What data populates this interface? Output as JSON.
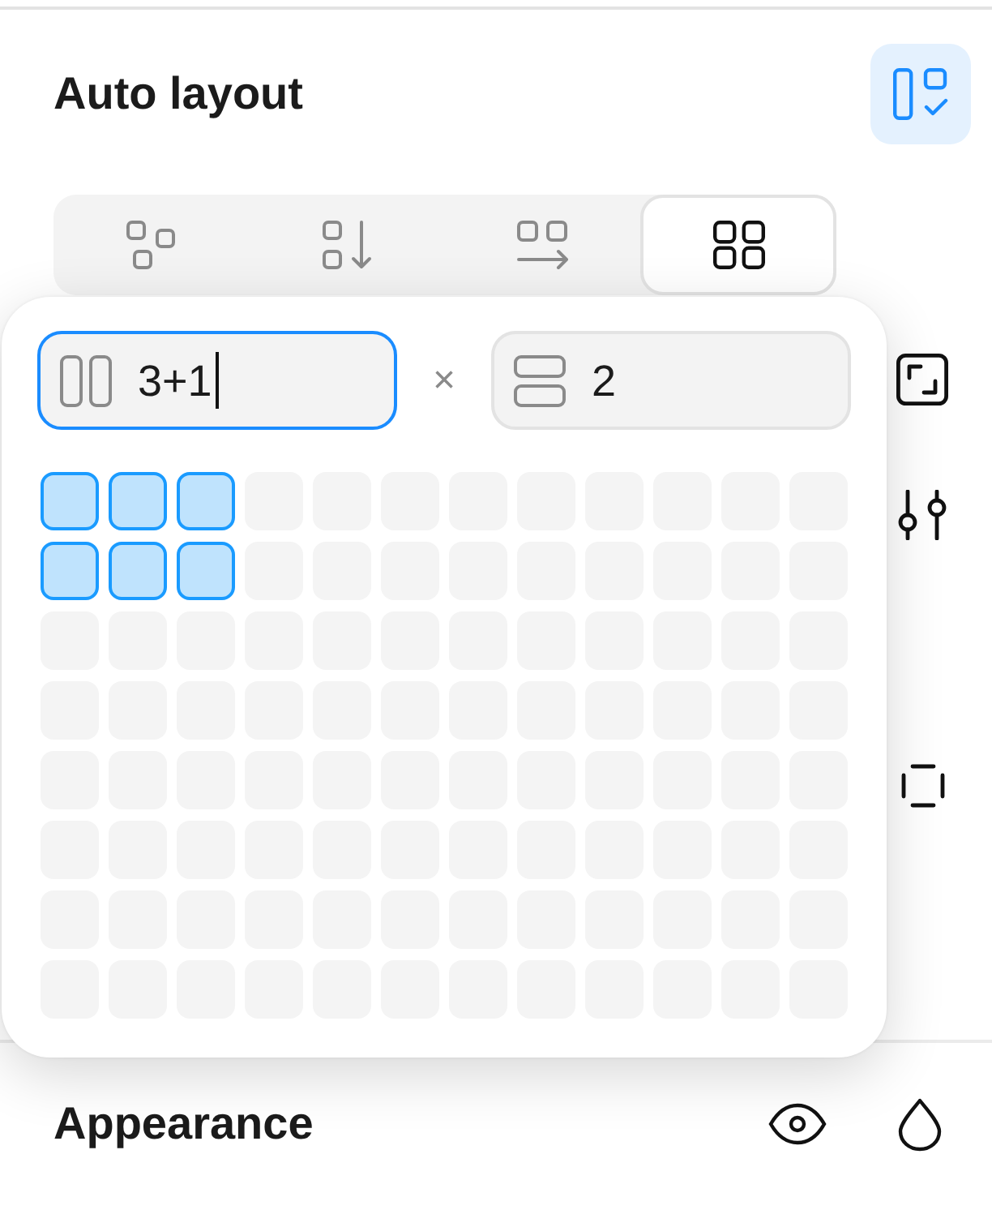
{
  "auto_layout": {
    "title": "Auto layout",
    "toggle": {
      "on": true
    }
  },
  "flow_options": [
    {
      "kind": "freeform",
      "selected": false
    },
    {
      "kind": "vertical",
      "selected": false
    },
    {
      "kind": "horizontal",
      "selected": false
    },
    {
      "kind": "grid",
      "selected": true
    }
  ],
  "grid_popover": {
    "columns_field": {
      "value": "3+1",
      "focused": true
    },
    "separator": "×",
    "rows_field": {
      "value": "2",
      "focused": false
    },
    "rows": [
      {
        "cells": [
          {
            "selected": true
          },
          {
            "selected": true
          },
          {
            "selected": true
          },
          {
            "selected": false
          },
          {
            "selected": false
          },
          {
            "selected": false
          },
          {
            "selected": false
          },
          {
            "selected": false
          },
          {
            "selected": false
          },
          {
            "selected": false
          },
          {
            "selected": false
          },
          {
            "selected": false
          }
        ]
      },
      {
        "cells": [
          {
            "selected": true
          },
          {
            "selected": true
          },
          {
            "selected": true
          },
          {
            "selected": false
          },
          {
            "selected": false
          },
          {
            "selected": false
          },
          {
            "selected": false
          },
          {
            "selected": false
          },
          {
            "selected": false
          },
          {
            "selected": false
          },
          {
            "selected": false
          },
          {
            "selected": false
          }
        ]
      },
      {
        "cells": [
          {
            "selected": false
          },
          {
            "selected": false
          },
          {
            "selected": false
          },
          {
            "selected": false
          },
          {
            "selected": false
          },
          {
            "selected": false
          },
          {
            "selected": false
          },
          {
            "selected": false
          },
          {
            "selected": false
          },
          {
            "selected": false
          },
          {
            "selected": false
          },
          {
            "selected": false
          }
        ]
      },
      {
        "cells": [
          {
            "selected": false
          },
          {
            "selected": false
          },
          {
            "selected": false
          },
          {
            "selected": false
          },
          {
            "selected": false
          },
          {
            "selected": false
          },
          {
            "selected": false
          },
          {
            "selected": false
          },
          {
            "selected": false
          },
          {
            "selected": false
          },
          {
            "selected": false
          },
          {
            "selected": false
          }
        ]
      },
      {
        "cells": [
          {
            "selected": false
          },
          {
            "selected": false
          },
          {
            "selected": false
          },
          {
            "selected": false
          },
          {
            "selected": false
          },
          {
            "selected": false
          },
          {
            "selected": false
          },
          {
            "selected": false
          },
          {
            "selected": false
          },
          {
            "selected": false
          },
          {
            "selected": false
          },
          {
            "selected": false
          }
        ]
      },
      {
        "cells": [
          {
            "selected": false
          },
          {
            "selected": false
          },
          {
            "selected": false
          },
          {
            "selected": false
          },
          {
            "selected": false
          },
          {
            "selected": false
          },
          {
            "selected": false
          },
          {
            "selected": false
          },
          {
            "selected": false
          },
          {
            "selected": false
          },
          {
            "selected": false
          },
          {
            "selected": false
          }
        ]
      },
      {
        "cells": [
          {
            "selected": false
          },
          {
            "selected": false
          },
          {
            "selected": false
          },
          {
            "selected": false
          },
          {
            "selected": false
          },
          {
            "selected": false
          },
          {
            "selected": false
          },
          {
            "selected": false
          },
          {
            "selected": false
          },
          {
            "selected": false
          },
          {
            "selected": false
          },
          {
            "selected": false
          }
        ]
      },
      {
        "cells": [
          {
            "selected": false
          },
          {
            "selected": false
          },
          {
            "selected": false
          },
          {
            "selected": false
          },
          {
            "selected": false
          },
          {
            "selected": false
          },
          {
            "selected": false
          },
          {
            "selected": false
          },
          {
            "selected": false
          },
          {
            "selected": false
          },
          {
            "selected": false
          },
          {
            "selected": false
          }
        ]
      }
    ]
  },
  "appearance": {
    "title": "Appearance"
  }
}
